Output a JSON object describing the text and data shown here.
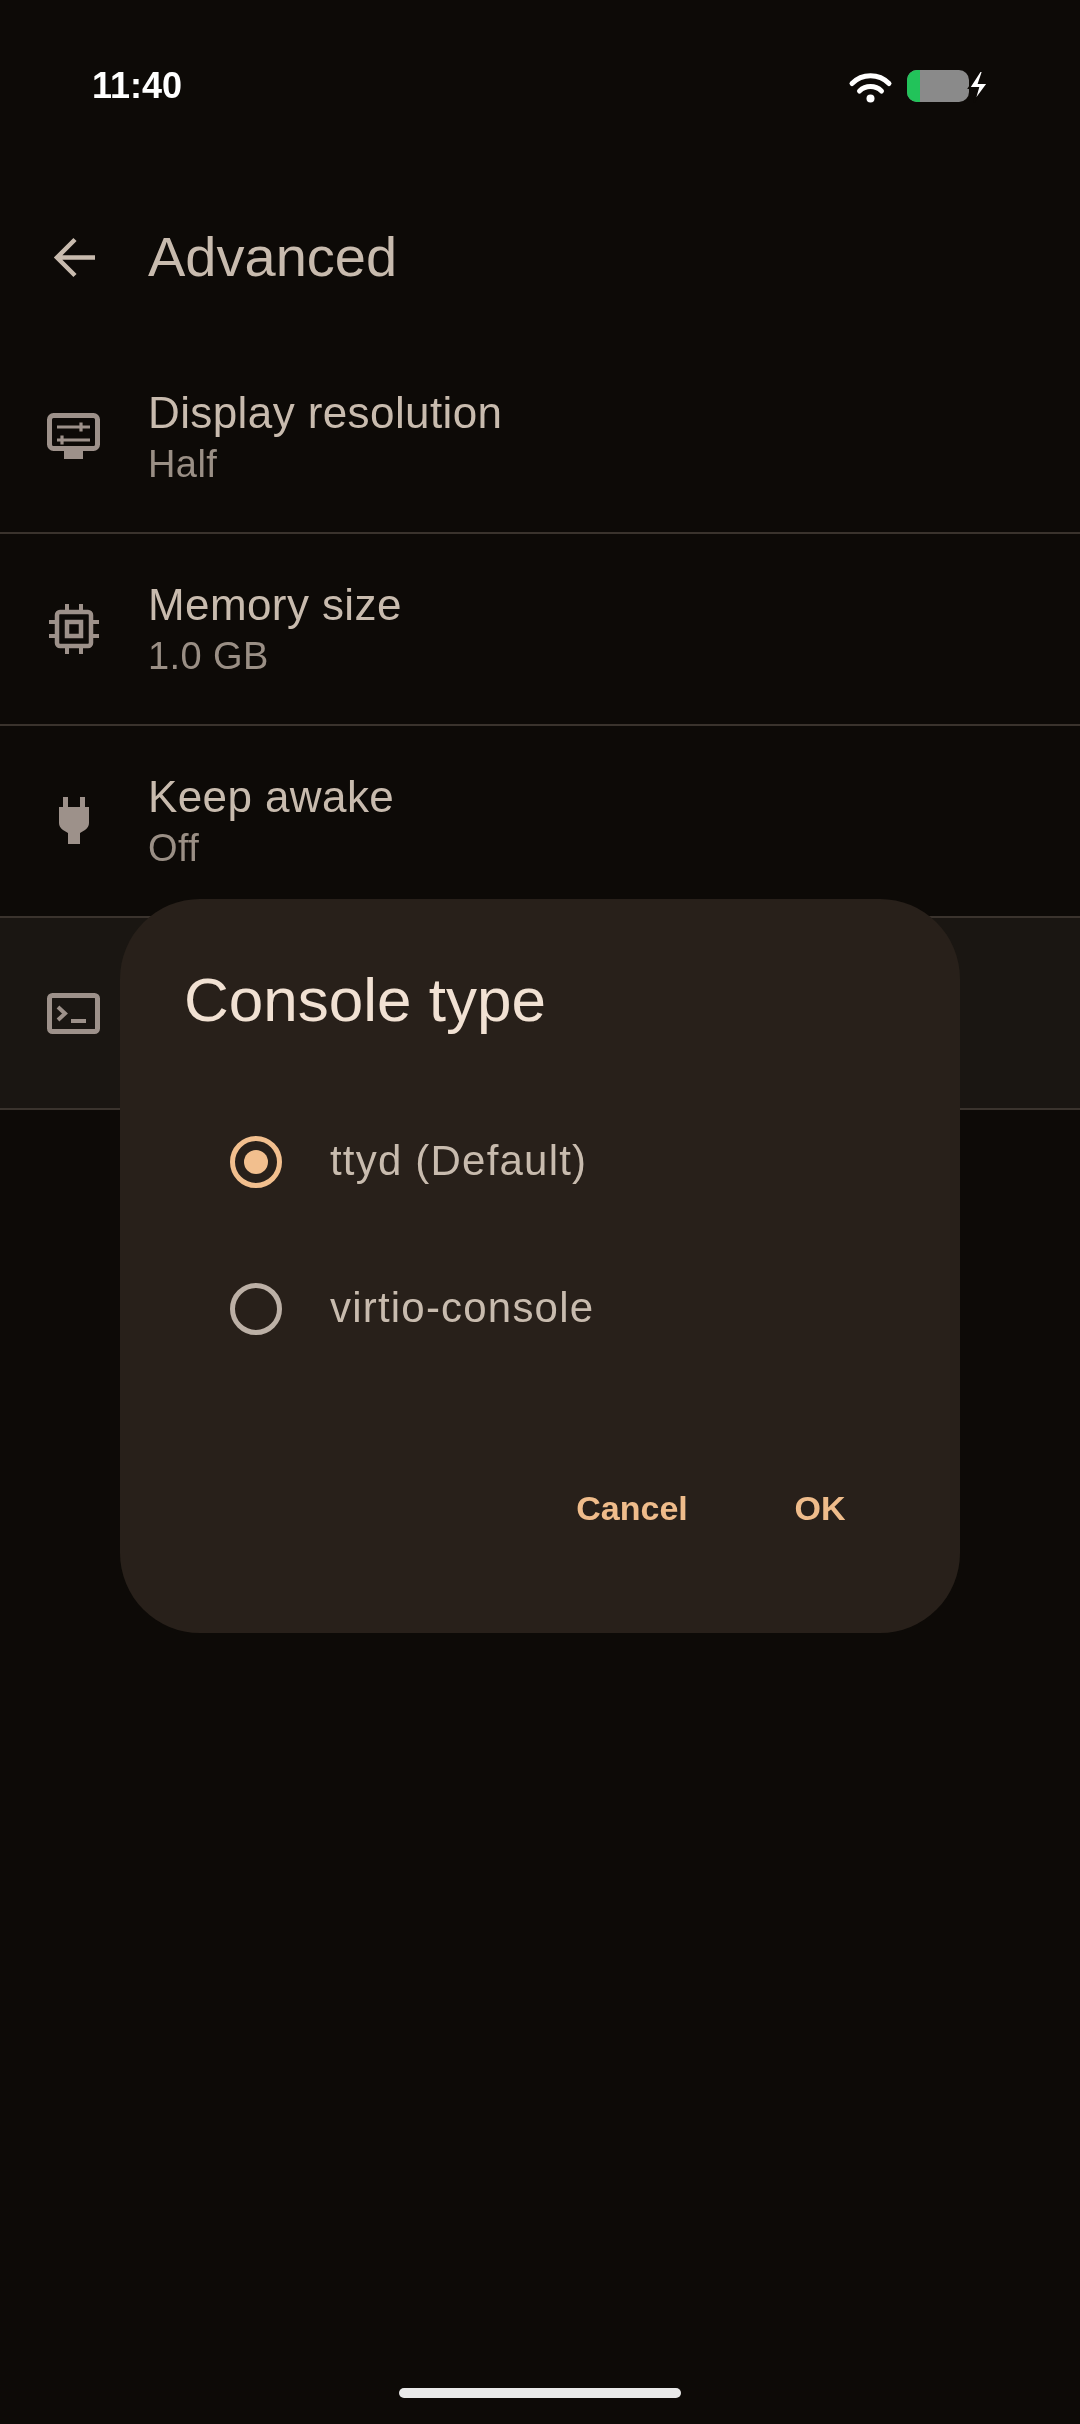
{
  "status_bar": {
    "time": "11:40"
  },
  "app_bar": {
    "title": "Advanced"
  },
  "settings": [
    {
      "title": "Display resolution",
      "summary": "Half",
      "highlighted": false
    },
    {
      "title": "Memory size",
      "summary": "1.0 GB",
      "highlighted": false
    },
    {
      "title": "Keep awake",
      "summary": "Off",
      "highlighted": false
    },
    {
      "highlighted": true
    }
  ],
  "dialog": {
    "title": "Console type",
    "options": [
      {
        "label": "ttyd (Default)",
        "selected": true
      },
      {
        "label": "virtio-console",
        "selected": false
      }
    ],
    "buttons": [
      "Cancel",
      "OK"
    ]
  }
}
